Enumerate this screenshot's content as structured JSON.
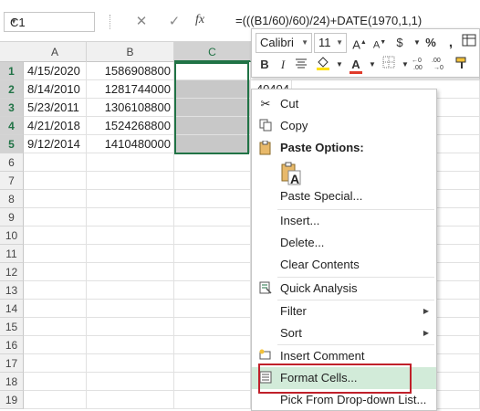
{
  "name_box": {
    "value": "C1"
  },
  "formula_bar": {
    "cancel": "✕",
    "enter": "✓",
    "fx": "fx",
    "formula": "=(((B1/60)/60)/24)+DATE(1970,1,1)"
  },
  "columns": [
    "A",
    "B",
    "C"
  ],
  "rows": [
    "1",
    "2",
    "3",
    "4",
    "5",
    "6",
    "7",
    "8",
    "9",
    "10",
    "11",
    "12",
    "13",
    "14",
    "15",
    "16",
    "17",
    "18",
    "19"
  ],
  "cells": {
    "col_a": [
      "4/15/2020",
      "8/14/2010",
      "5/23/2011",
      "4/21/2018",
      "9/12/2014"
    ],
    "col_b": [
      "1586908800",
      "1281744000",
      "1306108800",
      "1524268800",
      "1410480000"
    ],
    "c2": "40404"
  },
  "mini_toolbar": {
    "font": "Calibri",
    "size": "11",
    "grow": "A",
    "shrink": "A",
    "currency": "$",
    "percent": "%",
    "comma": ",",
    "bold": "B",
    "italic": "I",
    "fill_letter": "A"
  },
  "context_menu": {
    "cut": "Cut",
    "copy": "Copy",
    "paste_options": "Paste Options:",
    "paste_icon_letter": "A",
    "paste_special": "Paste Special...",
    "insert": "Insert...",
    "delete": "Delete...",
    "clear_contents": "Clear Contents",
    "quick_analysis": "Quick Analysis",
    "filter": "Filter",
    "sort": "Sort",
    "insert_comment": "Insert Comment",
    "format_cells": "Format Cells...",
    "pick_from_list": "Pick From Drop-down List..."
  },
  "colors": {
    "selection": "#217346",
    "highlight": "#d2ebd9",
    "callout": "#c0202a",
    "font_red": "#e03a2a",
    "fill_yellow": "#ffe000"
  }
}
